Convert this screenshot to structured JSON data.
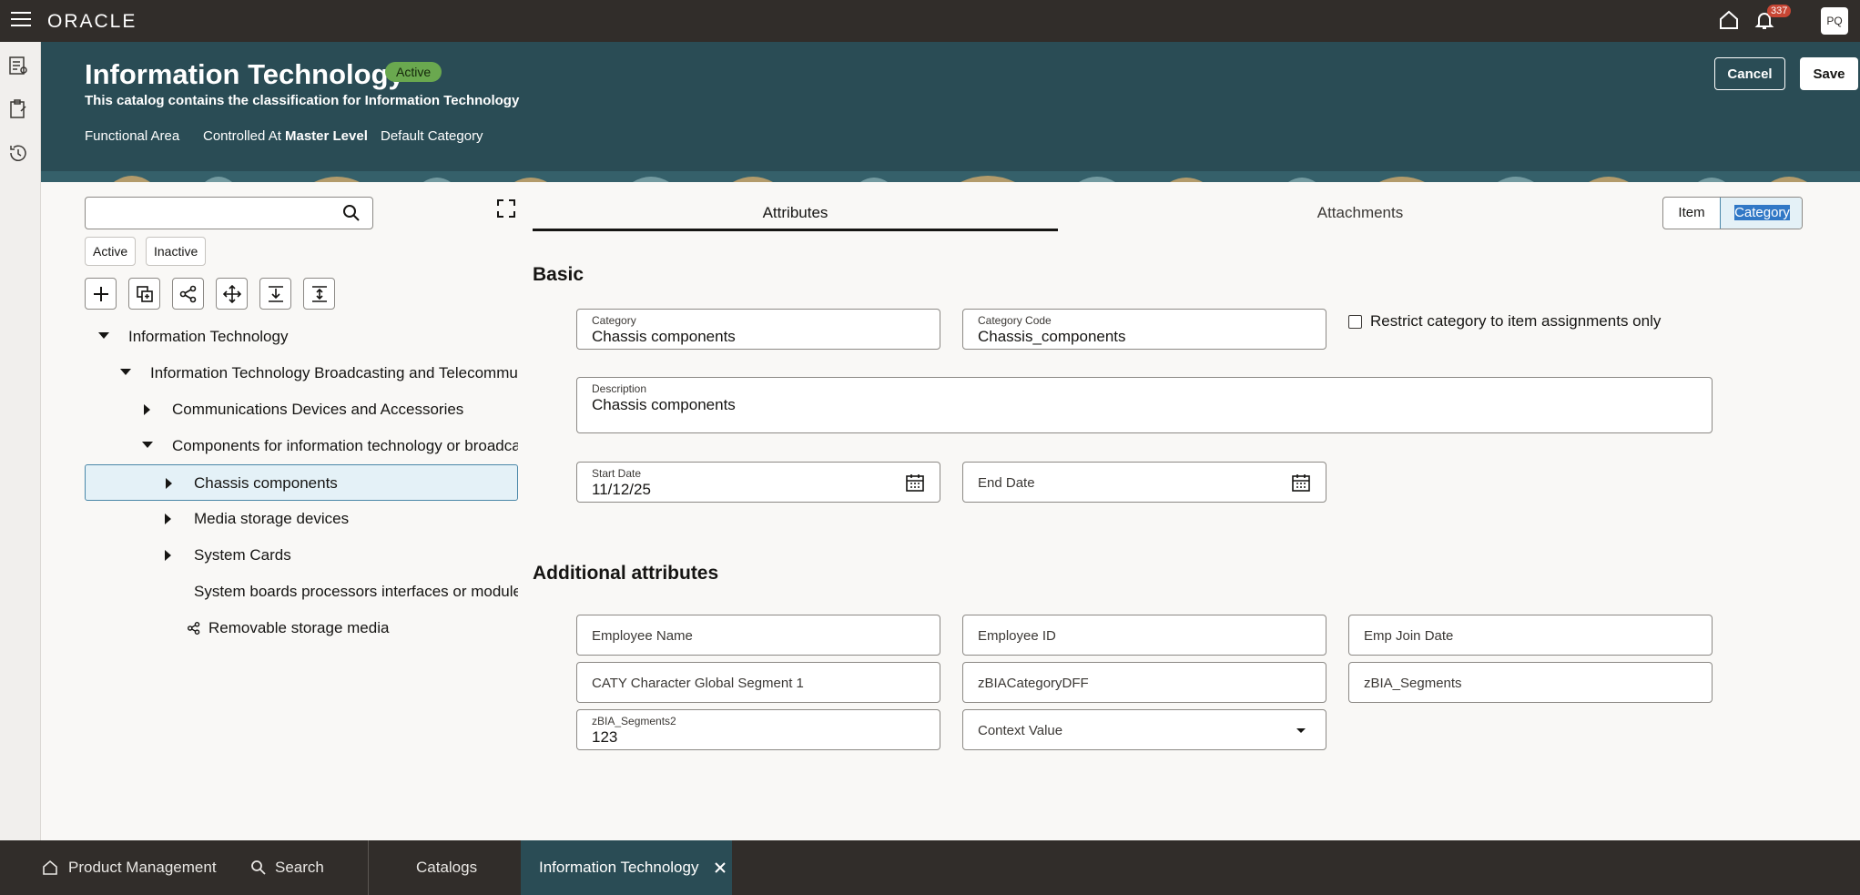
{
  "app": {
    "brand": "ORACLE",
    "notification_count": "337",
    "user_initials": "PQ"
  },
  "header": {
    "title": "Information Technology",
    "status": "Active",
    "subtitle": "This catalog contains the classification for Information Technology",
    "functional_area_label": "Functional Area",
    "controlled_at_label": "Controlled At",
    "controlled_at_value": "Master Level",
    "default_category_label": "Default Category",
    "cancel_label": "Cancel",
    "save_label": "Save"
  },
  "tree": {
    "search_placeholder": "",
    "filter_active": "Active",
    "filter_inactive": "Inactive",
    "tools": [
      "add-icon",
      "duplicate-icon",
      "share-icon",
      "move-icon",
      "expand-all-icon",
      "collapse-all-icon"
    ],
    "nodes": [
      {
        "label": "Information Technology",
        "caret": "down"
      },
      {
        "label": "Information Technology Broadcasting and Telecommunications",
        "caret": "down"
      },
      {
        "label": "Communications Devices and Accessories",
        "caret": "right"
      },
      {
        "label": "Components for information technology or broadcasting or telecommunications",
        "caret": "down"
      },
      {
        "label": "Chassis components",
        "caret": "right",
        "selected": true
      },
      {
        "label": "Media storage devices",
        "caret": "right"
      },
      {
        "label": "System Cards",
        "caret": "right"
      },
      {
        "label": "System boards processors interfaces or modules",
        "caret": "none"
      },
      {
        "label": "Removable storage media",
        "caret": "none",
        "shared": true
      }
    ]
  },
  "tabs": {
    "attributes": "Attributes",
    "attachments": "Attachments",
    "view_item": "Item",
    "view_category": "Category"
  },
  "basic": {
    "title": "Basic",
    "category_label": "Category",
    "category_value": "Chassis components",
    "code_label": "Category Code",
    "code_value": "Chassis_components",
    "restrict_label": "Restrict category to item assignments only",
    "description_label": "Description",
    "description_value": "Chassis components",
    "start_date_label": "Start Date",
    "start_date_value": "11/12/25",
    "end_date_label": "End Date"
  },
  "additional": {
    "title": "Additional attributes",
    "employee_name": "Employee Name",
    "employee_id": "Employee ID",
    "emp_join_date": "Emp Join Date",
    "caty_segment": "CATY Character Global Segment 1",
    "zbia_dff": "zBIACategoryDFF",
    "zbia_segments": "zBIA_Segments",
    "zbia_segments2_label": "zBIA_Segments2",
    "zbia_segments2_value": "123",
    "context_value": "Context Value"
  },
  "bottom": {
    "product_management": "Product Management",
    "search": "Search",
    "catalogs": "Catalogs",
    "information_technology": "Information Technology"
  },
  "colors": {
    "header_bg": "#2a4c55",
    "topbar_bg": "#312d2a",
    "active_badge": "#6aa84f",
    "badge_red": "#c74634"
  }
}
